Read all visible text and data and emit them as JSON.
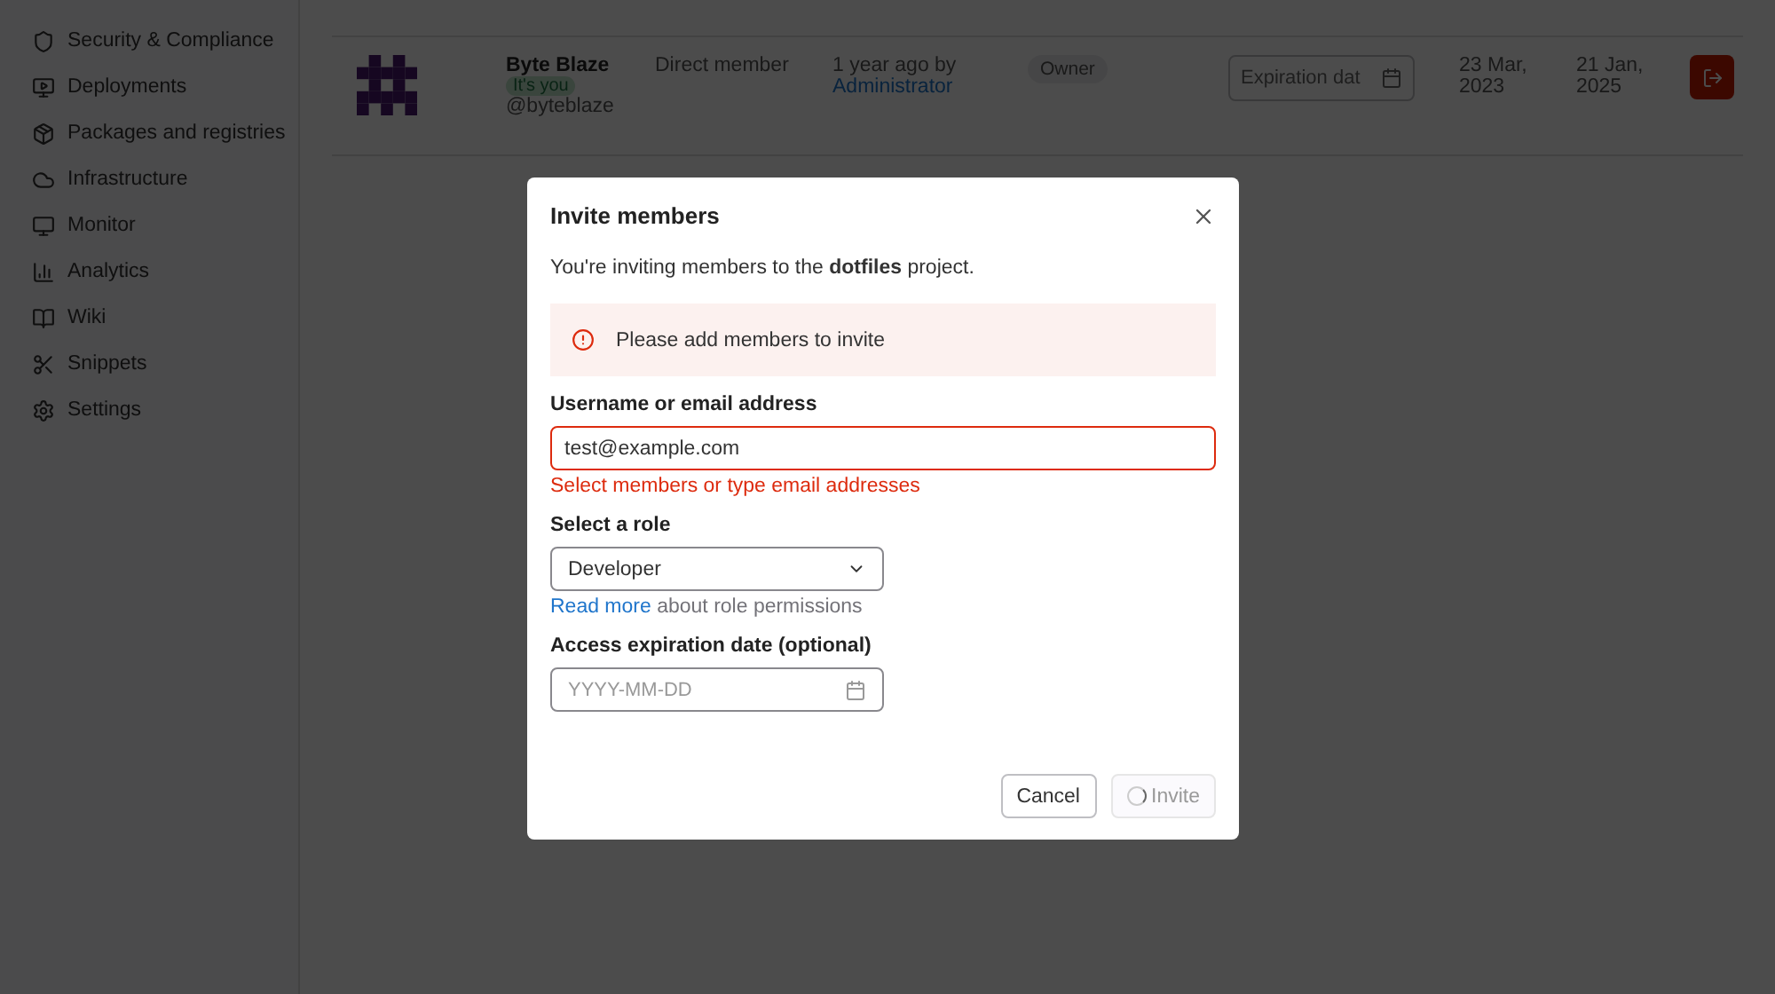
{
  "sidebar": {
    "items": [
      {
        "label": "Security & Compliance"
      },
      {
        "label": "Deployments"
      },
      {
        "label": "Packages and registries"
      },
      {
        "label": "Infrastructure"
      },
      {
        "label": "Monitor"
      },
      {
        "label": "Analytics"
      },
      {
        "label": "Wiki"
      },
      {
        "label": "Snippets"
      },
      {
        "label": "Settings"
      }
    ]
  },
  "member": {
    "name": "Byte Blaze",
    "badge": "It's you",
    "username": "@byteblaze",
    "source": "Direct member",
    "granted": "1 year ago by",
    "granted_by": "Administrator",
    "role": "Owner",
    "expiration_placeholder": "Expiration dat",
    "created": "23 Mar, 2023",
    "last_activity": "21 Jan, 2025"
  },
  "modal": {
    "title": "Invite members",
    "intro": "You're inviting members to the **dotfiles** project.",
    "alert": "Please add members to invite",
    "username_label": "Username or email address",
    "username_value": "test@example.com",
    "username_error": "Select members or type email addresses",
    "role_label": "Select a role",
    "role_value": "Developer",
    "help_link": "Read more",
    "help_text": "about role permissions",
    "date_label": "Access expiration date (optional)",
    "date_placeholder": "YYYY-MM-DD",
    "cancel": "Cancel",
    "invite": "Invite",
    "invite_disabled": true,
    "invite_loading": true
  }
}
